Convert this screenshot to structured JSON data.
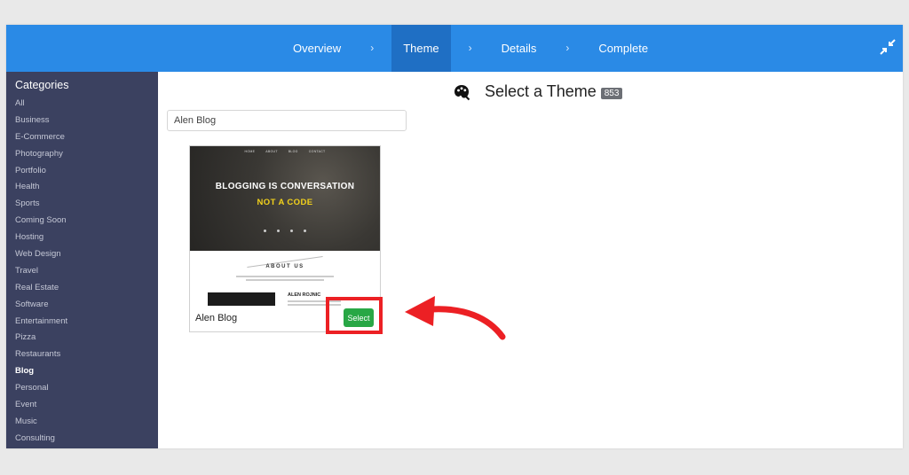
{
  "wizard": {
    "steps": [
      {
        "label": "Overview",
        "active": false
      },
      {
        "label": "Theme",
        "active": true
      },
      {
        "label": "Details",
        "active": false
      },
      {
        "label": "Complete",
        "active": false
      }
    ],
    "separator": "›",
    "collapse_icon": "collapse-arrows-icon"
  },
  "sidebar": {
    "title": "Categories",
    "items": [
      "All",
      "Business",
      "E-Commerce",
      "Photography",
      "Portfolio",
      "Health",
      "Sports",
      "Coming Soon",
      "Hosting",
      "Web Design",
      "Travel",
      "Real Estate",
      "Software",
      "Entertainment",
      "Pizza",
      "Restaurants",
      "Blog",
      "Personal",
      "Event",
      "Music",
      "Consulting"
    ],
    "active_item": "Blog"
  },
  "main": {
    "icon": "palette-icon",
    "heading": "Select a Theme",
    "count": "853",
    "search": {
      "value": "Alen Blog",
      "placeholder": ""
    }
  },
  "theme_card": {
    "name": "Alen Blog",
    "select_label": "Select",
    "preview": {
      "nav": [
        "HOME",
        "ABOUT",
        "BLOG",
        "CONTACT"
      ],
      "headline": "BLOGGING IS CONVERSATION",
      "subheadline": "NOT A CODE",
      "about_title": "ABOUT US",
      "author": "ALEN ROJNIC"
    }
  },
  "colors": {
    "topbar": "#2a8ae6",
    "active_step": "#1f6fc4",
    "sidebar": "#3b4160",
    "select_button": "#28a745",
    "highlight": "#ec2024"
  }
}
